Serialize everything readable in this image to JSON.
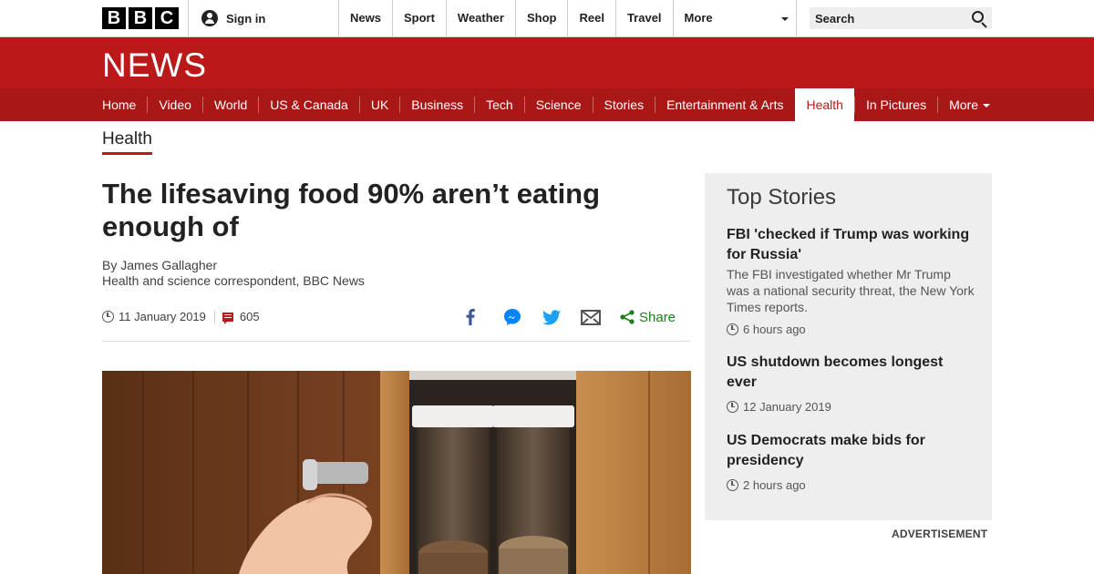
{
  "brand": {
    "letters": [
      "B",
      "B",
      "C"
    ]
  },
  "signin": {
    "label": "Sign in"
  },
  "topnav": {
    "items": [
      "News",
      "Sport",
      "Weather",
      "Shop",
      "Reel",
      "Travel",
      "More"
    ]
  },
  "search": {
    "placeholder": "Search"
  },
  "header": {
    "logo_text": "NEWS"
  },
  "sectionnav": {
    "items": [
      "Home",
      "Video",
      "World",
      "US & Canada",
      "UK",
      "Business",
      "Tech",
      "Science",
      "Stories",
      "Entertainment & Arts",
      "Health",
      "In Pictures",
      "More"
    ],
    "active": "Health"
  },
  "article": {
    "section": "Health",
    "headline": "The lifesaving food 90% aren’t eating enough of",
    "author": "By James Gallagher",
    "role": "Health and science correspondent, BBC News",
    "date": "11 January 2019",
    "comments": "605",
    "share_label": "Share"
  },
  "colors": {
    "brand_red": "#bb1919",
    "share_green": "#1a7f1a",
    "facebook": "#3b5998",
    "messenger": "#0084ff",
    "twitter": "#1da1f2"
  },
  "sidebar": {
    "title": "Top Stories",
    "stories": [
      {
        "headline": "FBI 'checked if Trump was working for Russia'",
        "summary": "The FBI investigated whether Mr Trump was a national security threat, the New York Times reports.",
        "time": "6 hours ago"
      },
      {
        "headline": "US shutdown becomes longest ever",
        "time": "12 January 2019"
      },
      {
        "headline": "US Democrats make bids for presidency",
        "time": "2 hours ago"
      }
    ],
    "advertisement": "ADVERTISEMENT"
  }
}
